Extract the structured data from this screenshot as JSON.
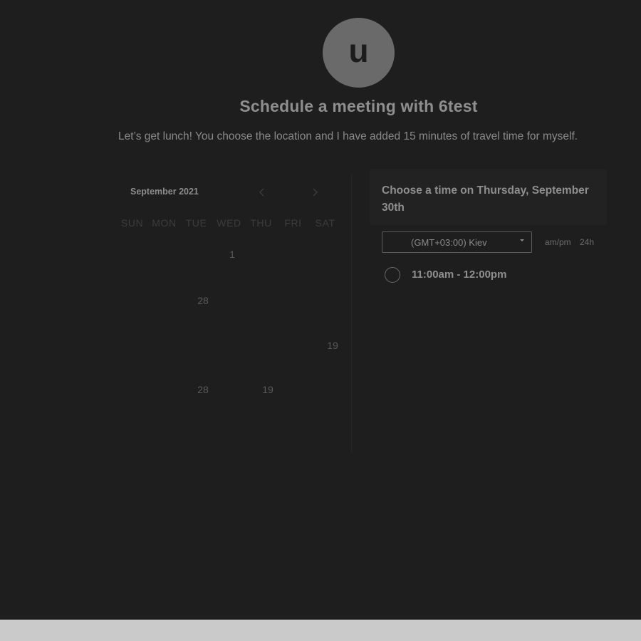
{
  "avatar": {
    "letter": "u"
  },
  "header": {
    "title": "Schedule a meeting with 6test",
    "description": "Let’s get lunch! You choose the location and I have added 15 minutes of travel time for myself."
  },
  "calendar": {
    "month_label": "September 2021",
    "prev_icon": "chevron-left-icon",
    "next_icon": "chevron-right-icon",
    "weekdays": [
      "SUN",
      "MON",
      "TUE",
      "WED",
      "THU",
      "FRI",
      "SAT"
    ],
    "visible_days": [
      {
        "row": 0,
        "col": 3,
        "label": "1"
      },
      {
        "row": 1,
        "col": 2,
        "label": "28"
      },
      {
        "row": 2,
        "col": 6,
        "label": "19"
      },
      {
        "row": 3,
        "col": 2,
        "label": "28"
      },
      {
        "row": 3,
        "col": 4,
        "label": "19"
      }
    ]
  },
  "time_panel": {
    "title": "Choose a time on Thursday, September 30th",
    "timezone": "(GMT+03:00) Kiev",
    "format_ampm": "am/pm",
    "format_24h": "24h",
    "slots": [
      {
        "label": "11:00am - 12:00pm"
      }
    ]
  },
  "colors": {
    "background": "#1e1e1e",
    "footer": "#cacaca",
    "avatar": "#6a6a6a"
  }
}
